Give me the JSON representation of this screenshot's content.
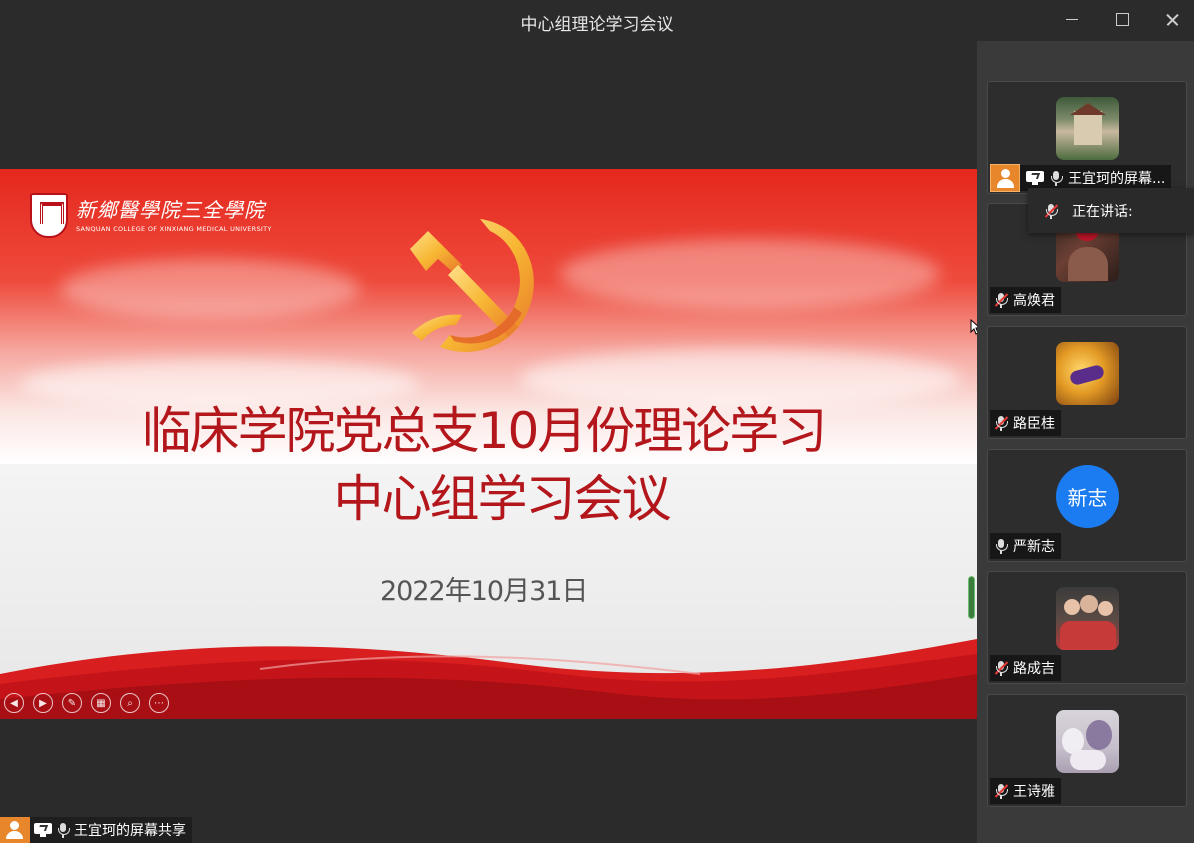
{
  "window": {
    "title": "中心组理论学习会议"
  },
  "slide": {
    "logo_cn": "新鄉醫學院三全學院",
    "logo_en": "SANQUAN COLLEGE OF XINXIANG MEDICAL UNIVERSITY",
    "title_line1": "临床学院党总支10月份理论学习",
    "title_line2": "中心组学习会议",
    "date": "2022年10月31日",
    "colors": {
      "title": "#b3161b",
      "banner": "#e5281e"
    },
    "controls": [
      "prev-icon",
      "next-icon",
      "pen-icon",
      "grid-icon",
      "zoom-icon",
      "more-icon"
    ]
  },
  "share_label": {
    "text": "王宜珂的屏幕共享"
  },
  "speaking_popup": {
    "label": "正在讲话:"
  },
  "participants": [
    {
      "name": "王宜珂的屏幕...",
      "avatar": "house-photo",
      "mic": "on",
      "sharing": true
    },
    {
      "name": "高焕君",
      "avatar": "woman-photo",
      "mic": "muted"
    },
    {
      "name": "路臣桂",
      "avatar": "logo-photo",
      "mic": "muted"
    },
    {
      "name": "严新志",
      "avatar_text": "新志",
      "mic": "on"
    },
    {
      "name": "路成吉",
      "avatar": "family-photo",
      "mic": "muted"
    },
    {
      "name": "王诗雅",
      "avatar": "plush-photo",
      "mic": "muted"
    }
  ]
}
